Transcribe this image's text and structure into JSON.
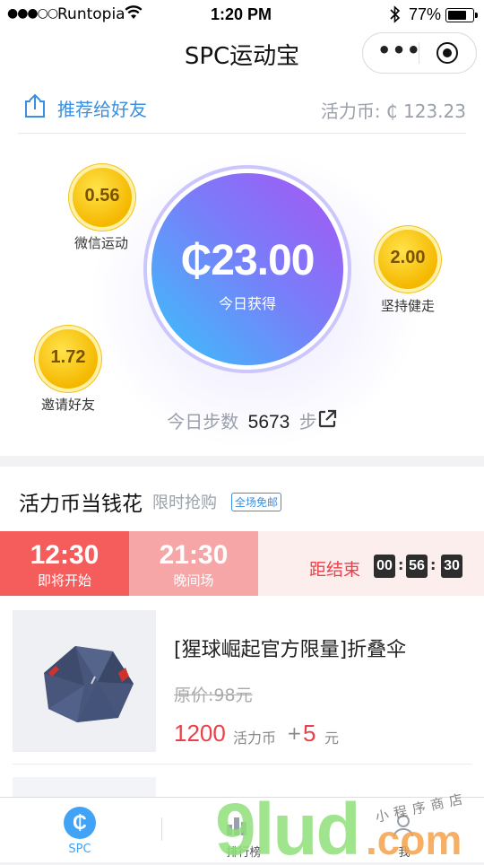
{
  "status_bar": {
    "signal": "●●●○○",
    "carrier": "Runtopia",
    "time": "1:20 PM",
    "battery_pct": "77%",
    "battery_level": 0.77
  },
  "nav": {
    "title": "SPC运动宝",
    "more_icon": "more-dots-icon",
    "close_icon": "target-circle-icon"
  },
  "header": {
    "share_label": "推荐给好友",
    "balance_label": "活力币: ₵ 123.23"
  },
  "earnings": {
    "amount": "₵23.00",
    "label": "今日获得",
    "coins": [
      {
        "value": "0.56",
        "label": "微信运动"
      },
      {
        "value": "2.00",
        "label": "坚持健走"
      },
      {
        "value": "1.72",
        "label": "邀请好友"
      }
    ],
    "steps_prefix": "今日步数",
    "steps_value": "5673",
    "steps_suffix": "步"
  },
  "shop": {
    "title": "活力币当钱花",
    "subtitle": "限时抢购",
    "tag": "全场免邮",
    "sessions": [
      {
        "time": "12:30",
        "label": "即将开始"
      },
      {
        "time": "21:30",
        "label": "晚间场"
      }
    ],
    "countdown_label": "距结束",
    "countdown": [
      "00",
      "56",
      "30"
    ],
    "product": {
      "name": "[猩球崛起官方限量]折叠伞",
      "original_price": "原价:98元",
      "price_coins": "1200",
      "coin_unit": "活力币",
      "plus": "+",
      "price_cash": "5",
      "cash_unit": "元"
    }
  },
  "tabbar": {
    "items": [
      {
        "label": "SPC",
        "icon": "spc-coin-icon"
      },
      {
        "label": "排行榜",
        "icon": "ranking-icon"
      },
      {
        "label": "我",
        "icon": "profile-icon"
      }
    ]
  },
  "watermark": {
    "brand": "9lud",
    "domain": ".com",
    "caption": "小程序商店"
  },
  "colors": {
    "accent_blue": "#3a8fe0",
    "accent_red": "#e8414a",
    "coin_gold": "#f5b800",
    "gradient_start": "#a855f4",
    "gradient_end": "#39c3fb"
  }
}
